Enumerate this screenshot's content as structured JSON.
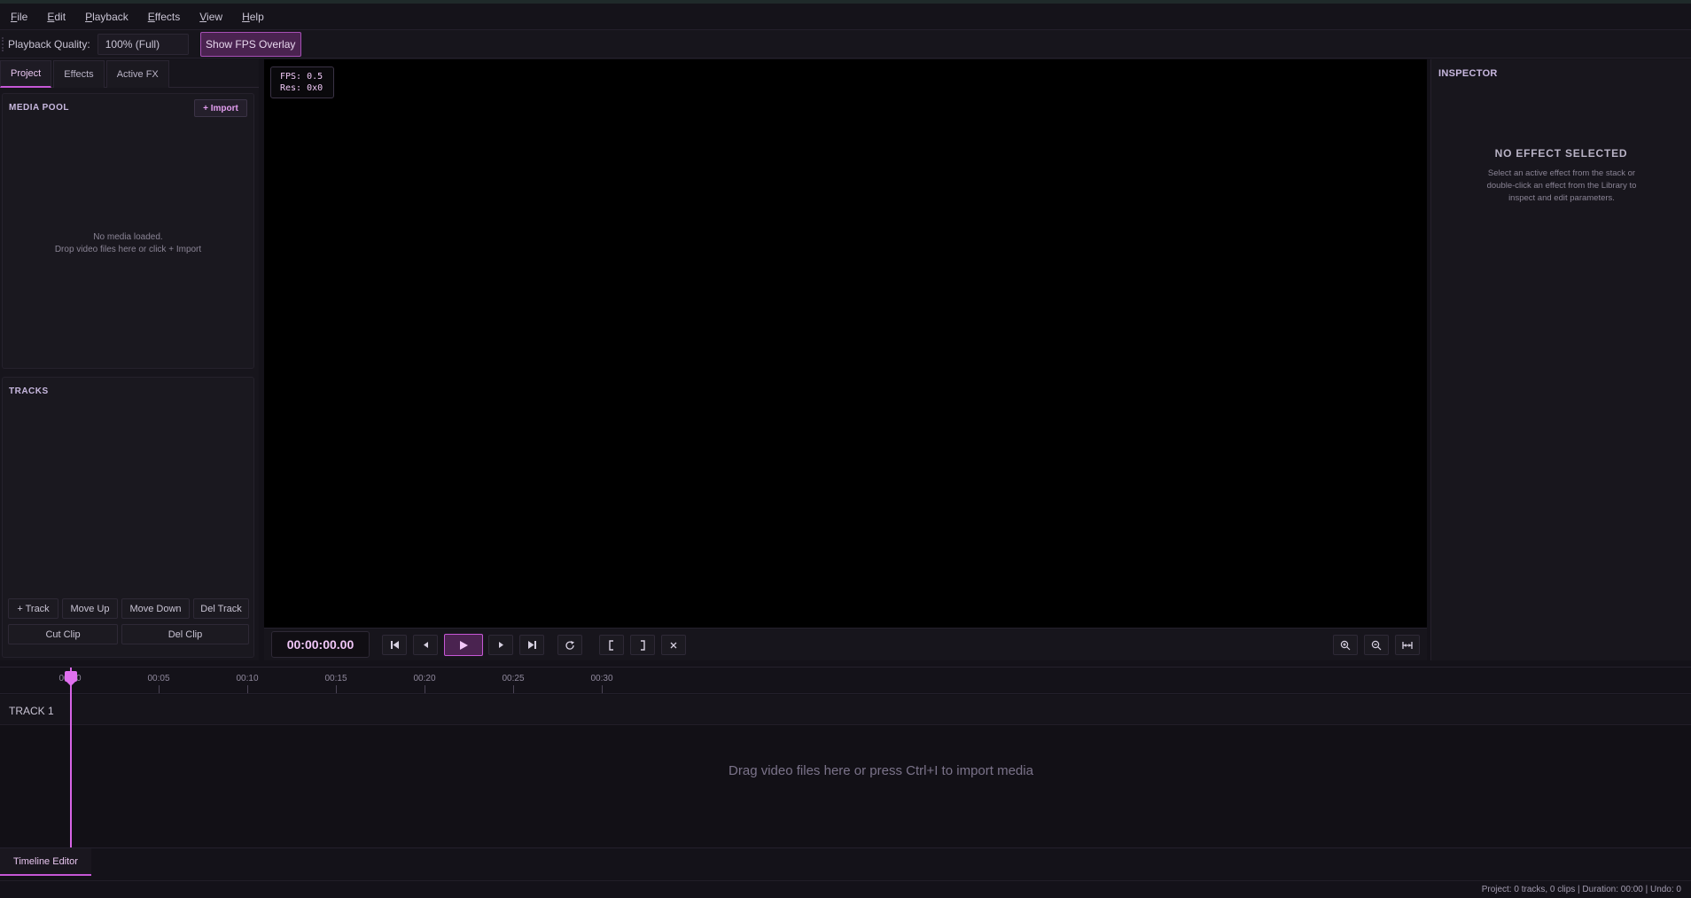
{
  "menu": [
    {
      "label": "File",
      "key": "F",
      "rest": "ile"
    },
    {
      "label": "Edit",
      "key": "E",
      "rest": "dit"
    },
    {
      "label": "Playback",
      "key": "P",
      "rest": "layback"
    },
    {
      "label": "Effects",
      "key": "E",
      "rest": "ffects"
    },
    {
      "label": "View",
      "key": "V",
      "rest": "iew"
    },
    {
      "label": "Help",
      "key": "H",
      "rest": "elp"
    }
  ],
  "toolbar": {
    "quality_label": "Playback Quality:",
    "quality_value": "100% (Full)",
    "fps_toggle_label": "Show FPS Overlay"
  },
  "left_tabs": [
    "Project",
    "Effects",
    "Active FX"
  ],
  "media_pool": {
    "title": "MEDIA POOL",
    "import_label": "+ Import",
    "empty_line1": "No media loaded.",
    "empty_line2": "Drop video files here or click + Import"
  },
  "tracks_panel": {
    "title": "TRACKS",
    "buttons": [
      "+ Track",
      "Move Up",
      "Move Down",
      "Del Track"
    ],
    "clip_buttons": [
      "Cut Clip",
      "Del Clip"
    ]
  },
  "viewer": {
    "fps_line": "FPS: 0.5",
    "res_line": "Res: 0x0"
  },
  "transport": {
    "timecode": "00:00:00.00"
  },
  "inspector": {
    "title": "INSPECTOR",
    "heading": "NO EFFECT SELECTED",
    "message": "Select an active effect from the stack or double-click an effect from the Library to inspect and edit parameters."
  },
  "timeline": {
    "ticks": [
      "00:00",
      "00:05",
      "00:10",
      "00:15",
      "00:20",
      "00:25",
      "00:30"
    ],
    "track_name": "TRACK 1",
    "drop_message": "Drag video files here or press Ctrl+I to import media"
  },
  "bottom_tab": "Timeline Editor",
  "status": "Project: 0 tracks, 0 clips | Duration: 00:00 | Undo: 0",
  "colors": {
    "accent": "#c657d6",
    "background": "#141219",
    "viewer": "#000000"
  }
}
